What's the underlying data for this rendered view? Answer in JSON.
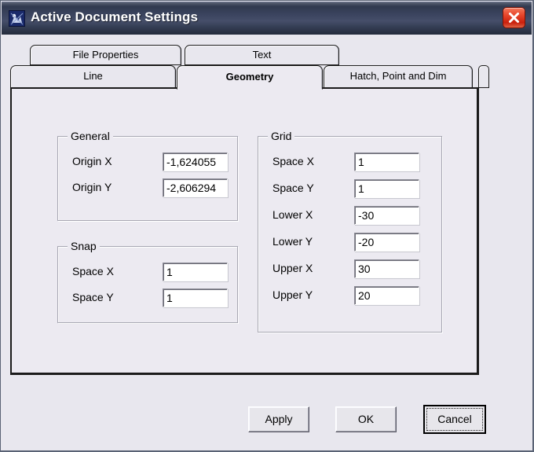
{
  "window": {
    "title": "Active Document Settings",
    "icon": "document-settings-icon",
    "close_label": "close-icon"
  },
  "tabs": {
    "top_row": [
      {
        "label": "File Properties",
        "active": false
      },
      {
        "label": "Text",
        "active": false
      }
    ],
    "bottom_row": [
      {
        "label": "Line",
        "active": false
      },
      {
        "label": "Geometry",
        "active": true
      },
      {
        "label": "Hatch, Point and Dim",
        "active": false
      }
    ]
  },
  "panel": {
    "groups": {
      "general": {
        "title": "General",
        "fields": [
          {
            "label": "Origin X",
            "value": "-1,624055"
          },
          {
            "label": "Origin Y",
            "value": "-2,606294"
          }
        ]
      },
      "snap": {
        "title": "Snap",
        "fields": [
          {
            "label": "Space X",
            "value": "1"
          },
          {
            "label": "Space Y",
            "value": "1"
          }
        ]
      },
      "grid": {
        "title": "Grid",
        "fields": [
          {
            "label": "Space X",
            "value": "1"
          },
          {
            "label": "Space Y",
            "value": "1"
          },
          {
            "label": "Lower X",
            "value": "-30"
          },
          {
            "label": "Lower Y",
            "value": "-20"
          },
          {
            "label": "Upper X",
            "value": "30"
          },
          {
            "label": "Upper Y",
            "value": "20"
          }
        ]
      }
    }
  },
  "buttons": {
    "apply": "Apply",
    "ok": "OK",
    "cancel": "Cancel"
  },
  "colors": {
    "dialog_background": "#e8e7ee",
    "panel_background": "#eceaf1",
    "titlebar_dark": "#242b3c",
    "titlebar_light": "#454e69",
    "close_button_red": "#e8472c",
    "field_background": "#ffffff",
    "text": "#000000"
  }
}
